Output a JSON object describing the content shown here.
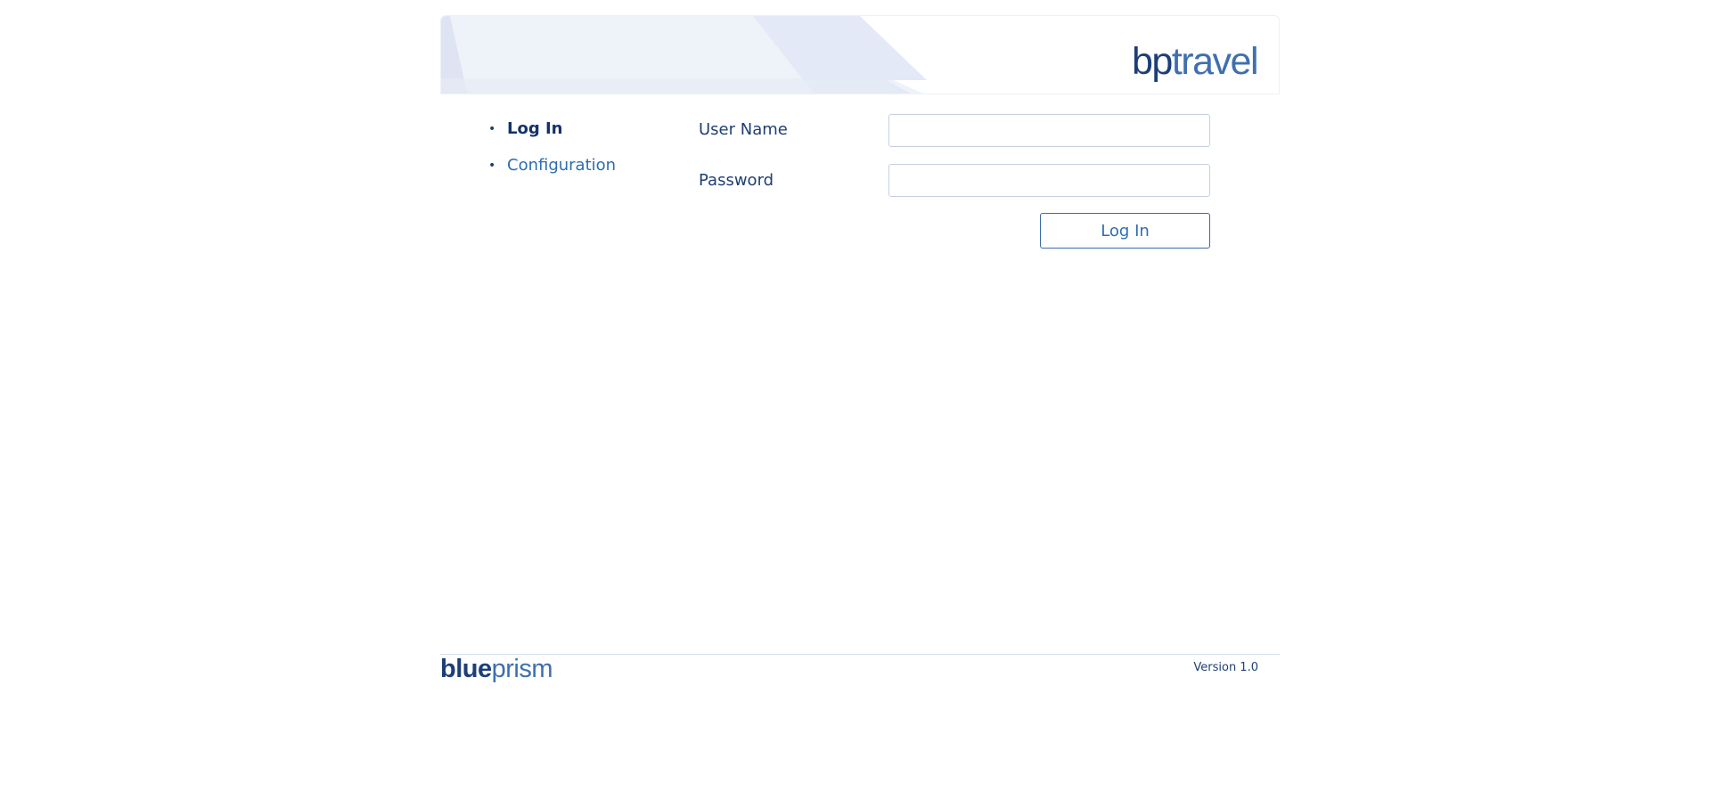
{
  "header": {
    "logo_prefix": "bp",
    "logo_suffix": "travel"
  },
  "nav": {
    "items": [
      {
        "label": "Log In",
        "active": true
      },
      {
        "label": "Configuration",
        "active": false
      }
    ]
  },
  "form": {
    "username_label": "User Name",
    "username_value": "",
    "password_label": "Password",
    "password_value": "",
    "submit_label": "Log In"
  },
  "footer": {
    "logo_bold": "blue",
    "logo_light": "prism",
    "version": "Version 1.0"
  },
  "colors": {
    "primary": "#1f3f73",
    "link": "#2d6db0",
    "border": "#c5cfe0"
  }
}
